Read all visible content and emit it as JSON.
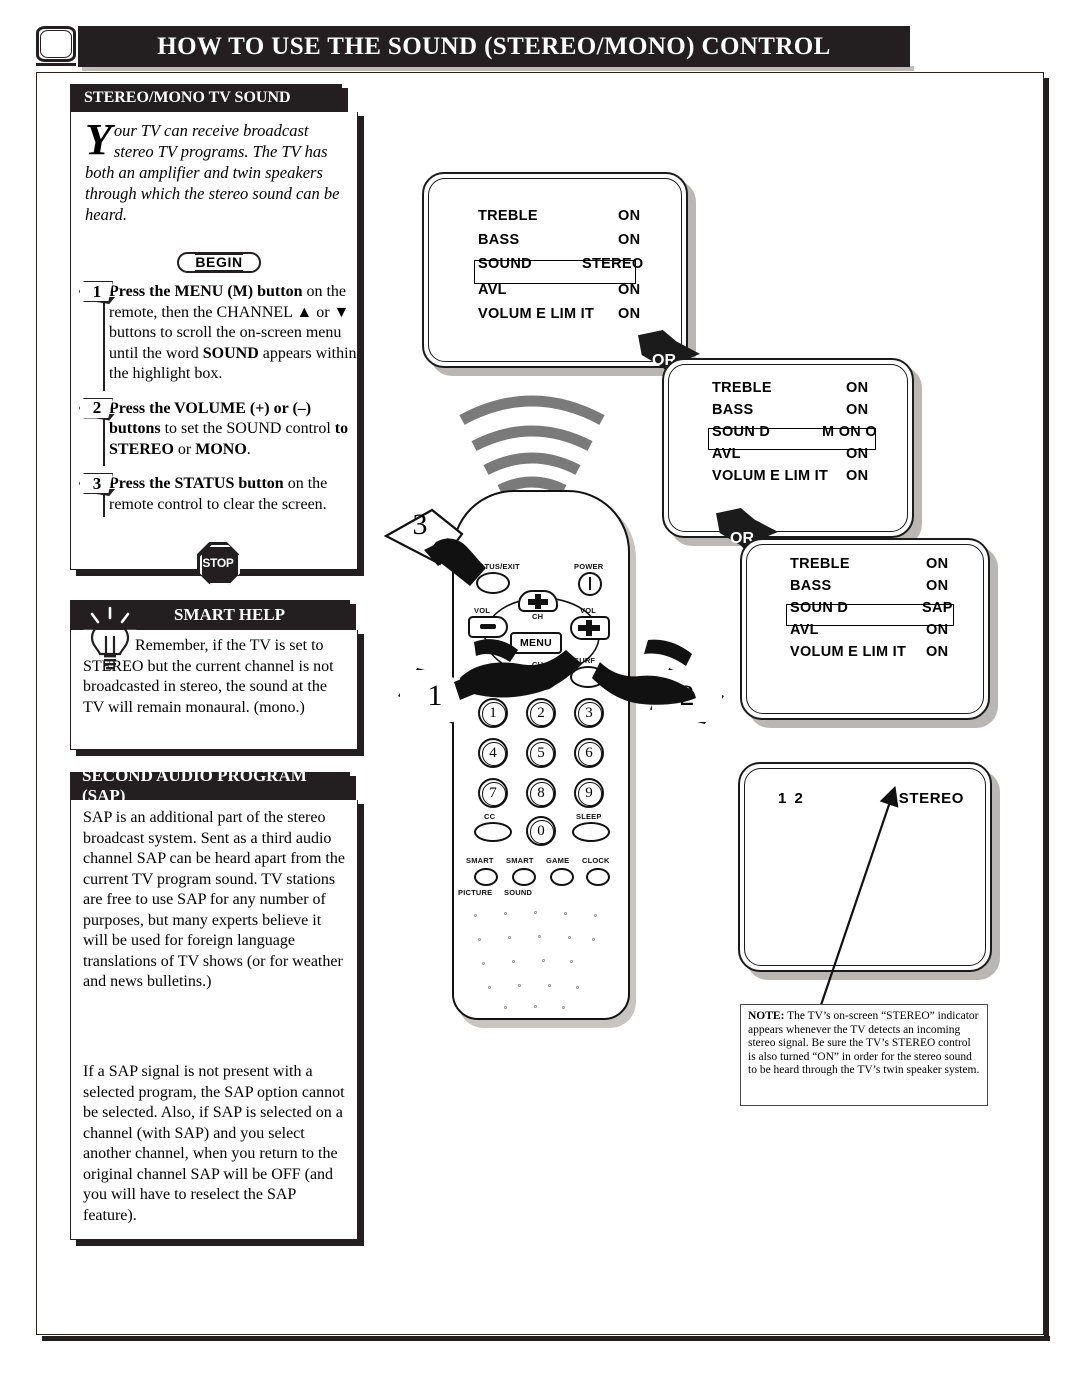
{
  "header": {
    "title": "HOW TO USE THE SOUND (STEREO/MONO) CONTROL",
    "tv_icon": "tv-icon"
  },
  "stereo_mono_panel": {
    "caption": "STEREO/MONO TV SOUND",
    "dropcap": "Y",
    "intro": "our TV can receive broadcast stereo TV programs.  The TV has both an amplifier and twin speakers through which the stereo sound can be heard.",
    "begin_label": "BEGIN",
    "stop_label": "STOP",
    "steps": [
      {
        "number": "1",
        "html": "<b>Press the MENU (M) button</b> on the remote,  then the CHANNEL ▲ or ▼ buttons to scroll the on-screen menu until the word <b>SOUND</b> appears within the highlight box."
      },
      {
        "number": "2",
        "html": "<b>Press the VOLUME (+) or (–) buttons</b> to set the SOUND control <b>to STEREO</b> or <b>MONO</b>."
      },
      {
        "number": "3",
        "html": "<b>Press the STATUS button</b> on the remote control to clear the screen."
      }
    ]
  },
  "smart_help_panel": {
    "caption": "SMART HELP",
    "icon": "lightbulb-icon",
    "text": "Remember, if the TV is set to STEREO but the current channel is not broadcasted in stereo, the sound at the TV will remain monaural. (mono.)"
  },
  "sap_panel": {
    "caption": "SECOND AUDIO PROGRAM (SAP)",
    "paragraphs": [
      "SAP is an additional part of the stereo broadcast system. Sent as a third audio channel SAP can be heard apart from the current TV program sound. TV stations are free to use SAP for any number of purposes, but many experts believe it will be used for foreign language translations of TV shows (or for weather and news bulletins.)",
      "If a SAP signal is not present with a selected program, the SAP option cannot be selected. Also, if SAP is selected on a channel (with SAP) and you select another channel, when you return to the original channel SAP will be OFF (and you will have to reselect the SAP feature)."
    ]
  },
  "tv_menus": [
    {
      "id": "menu-stereo",
      "rows": [
        {
          "label": "TREBLE",
          "value": "ON",
          "highlighted": false
        },
        {
          "label": "BASS",
          "value": "ON",
          "highlighted": false
        },
        {
          "label": "SOUND",
          "value": "STEREO",
          "highlighted": true
        },
        {
          "label": "AVL",
          "value": "ON",
          "highlighted": false
        },
        {
          "label": "VOLUM E LIM IT",
          "value": "ON",
          "highlighted": false
        }
      ]
    },
    {
      "id": "menu-mono",
      "rows": [
        {
          "label": "TREBLE",
          "value": "ON",
          "highlighted": false
        },
        {
          "label": "BASS",
          "value": "ON",
          "highlighted": false
        },
        {
          "label": "SOUN D",
          "value": "M ON O",
          "highlighted": true
        },
        {
          "label": "AVL",
          "value": "ON",
          "highlighted": false
        },
        {
          "label": "VOLUM E LIM IT",
          "value": "ON",
          "highlighted": false
        }
      ]
    },
    {
      "id": "menu-sap",
      "rows": [
        {
          "label": "TREBLE",
          "value": "ON",
          "highlighted": false
        },
        {
          "label": "BASS",
          "value": "ON",
          "highlighted": false
        },
        {
          "label": "SOUN D",
          "value": "SAP",
          "highlighted": true
        },
        {
          "label": "AVL",
          "value": "ON",
          "highlighted": false
        },
        {
          "label": "VOLUM E LIM IT",
          "value": "ON",
          "highlighted": false
        }
      ]
    }
  ],
  "or_markers": [
    "OR",
    "OR",
    "OR"
  ],
  "bottom_tv": {
    "channel": "1 2",
    "indicator": "STEREO"
  },
  "note": {
    "label": "NOTE:",
    "text": " The TV’s on-screen “STEREO” indicator appears whenever the TV detects an incoming stereo signal. Be sure the TV’s STEREO control is also turned “ON” in order for the stereo sound to be heard through the TV’s twin speaker system."
  },
  "remote": {
    "labels": {
      "status_exit": "STATUS/EXIT",
      "power": "POWER",
      "vol_left": "VOL",
      "vol_right": "VOL",
      "ch_up": "CH",
      "ch_down": "CH",
      "menu": "MENU",
      "surf": "SURF",
      "cc": "CC",
      "sleep": "SLEEP",
      "smart1": "SMART",
      "smart2": "SMART",
      "game": "GAME",
      "clock": "CLOCK",
      "picture": "PICTURE",
      "sound": "SOUND"
    },
    "keypad": [
      "1",
      "2",
      "3",
      "4",
      "5",
      "6",
      "7",
      "8",
      "9",
      "0"
    ]
  },
  "callouts": [
    {
      "number": "1"
    },
    {
      "number": "2"
    },
    {
      "number": "3"
    }
  ],
  "colors": {
    "ink": "#231f20",
    "paper": "#ffffff",
    "shadow": "#b9b6b4",
    "wave": "#7a7a7a"
  }
}
